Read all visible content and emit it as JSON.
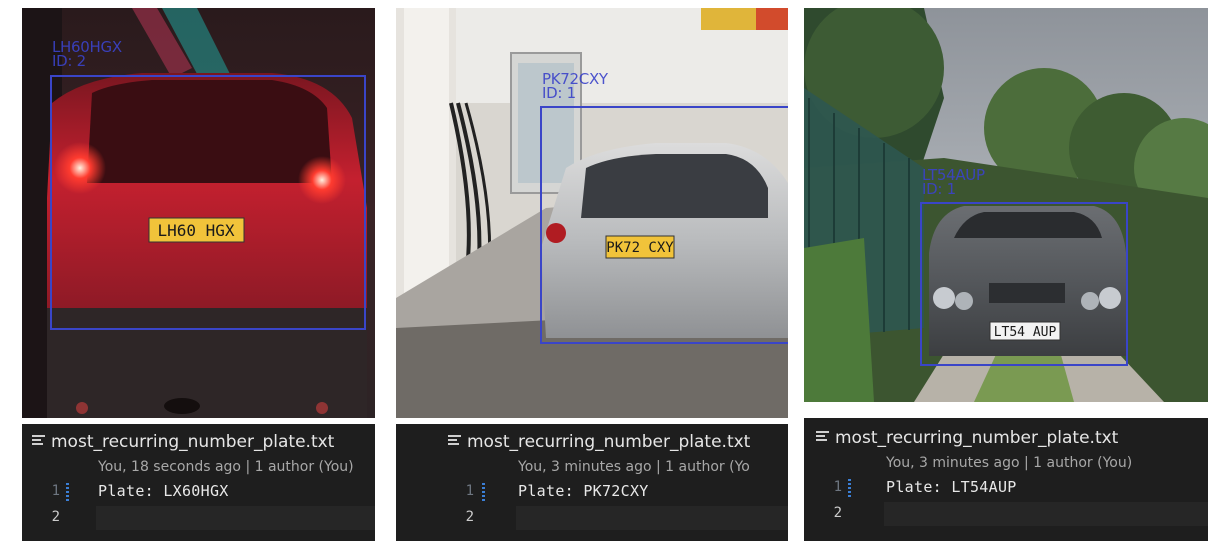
{
  "panels": [
    {
      "detection": {
        "plate_label": "LH60HGX",
        "id_label": "ID: 2"
      },
      "plate_text": "LH60 HGX",
      "editor": {
        "filename": "most_recurring_number_plate.txt",
        "blame": "You, 18 seconds ago | 1 author (You)",
        "lines": [
          {
            "number": "1",
            "text": "Plate: LX60HGX"
          },
          {
            "number": "2",
            "text": ""
          }
        ]
      }
    },
    {
      "detection": {
        "plate_label": "PK72CXY",
        "id_label": "ID: 1"
      },
      "plate_text": "PK72 CXY",
      "editor": {
        "filename": "most_recurring_number_plate.txt",
        "blame": "You, 3 minutes ago | 1 author (Yo",
        "lines": [
          {
            "number": "1",
            "text": "Plate: PK72CXY"
          },
          {
            "number": "2",
            "text": ""
          }
        ]
      }
    },
    {
      "detection": {
        "plate_label": "LT54AUP",
        "id_label": "ID: 1"
      },
      "plate_text": "LT54 AUP",
      "editor": {
        "filename": "most_recurring_number_plate.txt",
        "blame": "You, 3 minutes ago | 1 author (You)",
        "lines": [
          {
            "number": "1",
            "text": "Plate: LT54AUP"
          },
          {
            "number": "2",
            "text": ""
          }
        ]
      }
    }
  ],
  "colors": {
    "detection_box": "#3a45c8",
    "editor_bg": "#1e1e1e",
    "gutter_indicator": "#3b7fd6"
  },
  "icons": {
    "editor_file_icon": "menu-lines-icon"
  }
}
